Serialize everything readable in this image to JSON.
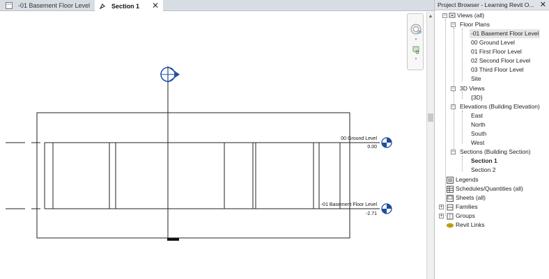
{
  "tabs": [
    {
      "label": "-01 Basement Floor Level"
    },
    {
      "label": "Section 1"
    }
  ],
  "close_glyph": "✕",
  "drawing": {
    "levels": [
      {
        "name": "00 Ground Level",
        "elevation": "0.00"
      },
      {
        "name": "-01 Basement Floor Level",
        "elevation": "-2.71"
      }
    ]
  },
  "project_browser": {
    "title": "Project Browser - Learning Revit O...",
    "views_all": "Views (all)",
    "floor_plans": "Floor Plans",
    "floor_plan_items": [
      "-01 Basement Floor Level",
      "00 Ground Level",
      "01 First Floor Level",
      "02 Second Floor Level",
      "03 Third Floor Level",
      "Site"
    ],
    "views_3d": "3D Views",
    "views_3d_items": [
      "{3D}"
    ],
    "elevations": "Elevations (Building Elevation)",
    "elevation_items": [
      "East",
      "North",
      "South",
      "West"
    ],
    "sections": "Sections (Building Section)",
    "section_items": [
      "Section 1",
      "Section 2"
    ],
    "legends": "Legends",
    "schedules": "Schedules/Quantities (all)",
    "sheets": "Sheets (all)",
    "families": "Families",
    "groups": "Groups",
    "revit_links": "Revit Links"
  },
  "colors": {
    "level_head_blue": "#1f4e9e",
    "link_yellow": "#e6b800"
  }
}
